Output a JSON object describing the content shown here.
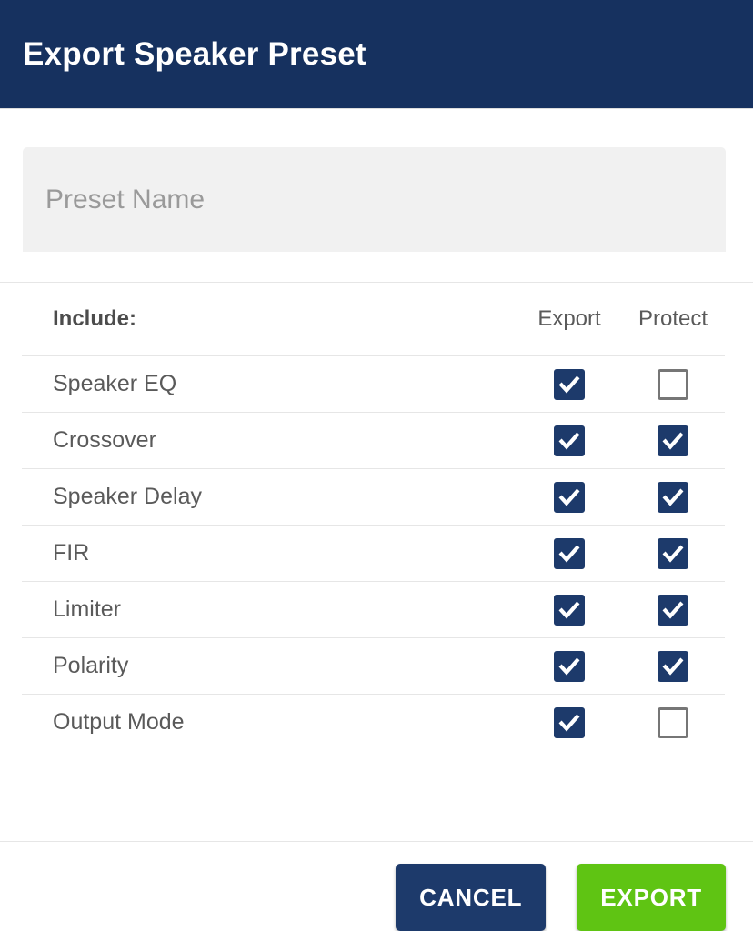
{
  "header": {
    "title": "Export Speaker Preset"
  },
  "preset_name_field": {
    "value": "",
    "placeholder": "Preset Name"
  },
  "table": {
    "headers": {
      "label": "Include:",
      "export": "Export",
      "protect": "Protect"
    },
    "rows": [
      {
        "label": "Speaker EQ",
        "export": true,
        "protect": false
      },
      {
        "label": "Crossover",
        "export": true,
        "protect": true
      },
      {
        "label": "Speaker Delay",
        "export": true,
        "protect": true
      },
      {
        "label": "FIR",
        "export": true,
        "protect": true
      },
      {
        "label": "Limiter",
        "export": true,
        "protect": true
      },
      {
        "label": "Polarity",
        "export": true,
        "protect": true
      },
      {
        "label": "Output Mode",
        "export": true,
        "protect": false
      }
    ]
  },
  "footer": {
    "cancel_label": "CANCEL",
    "export_label": "EXPORT"
  },
  "colors": {
    "header_navy": "#16315f",
    "checkbox_navy": "#1d3a6b",
    "export_green": "#5fc413",
    "field_gray": "#f1f1f1",
    "divider_gray": "#e6e6e6",
    "label_gray": "#5a5a5a",
    "placeholder_gray": "#9a9a9a",
    "unchecked_border": "#767676"
  }
}
